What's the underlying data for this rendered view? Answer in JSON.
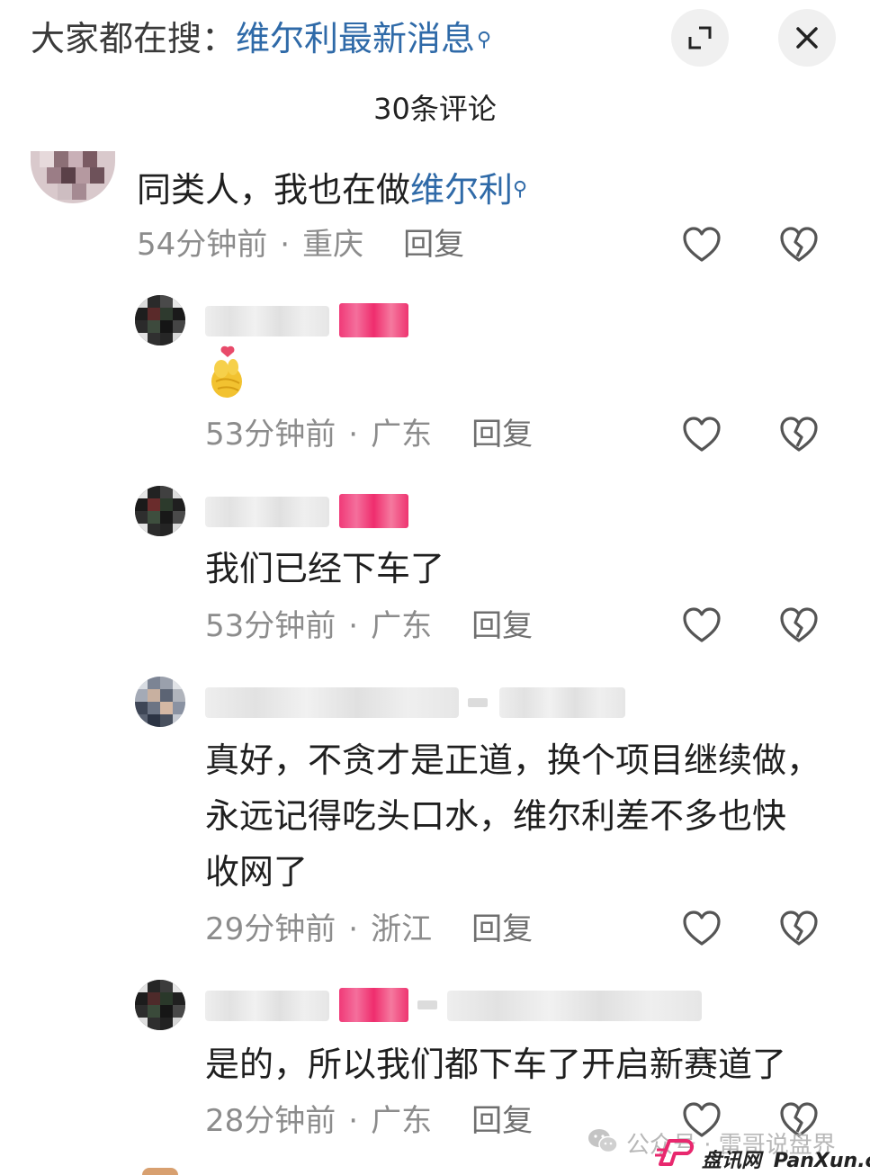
{
  "header": {
    "search_prefix": "大家都在搜：",
    "search_keyword": "维尔利最新消息",
    "comment_count": "30条评论"
  },
  "comments": [
    {
      "text_plain": "同类人，我也在做",
      "text_keyword": "维尔利",
      "time": "54分钟前",
      "location": "重庆",
      "reply": "回复"
    },
    {
      "emoji": "🫰",
      "time": "53分钟前",
      "location": "广东",
      "reply": "回复"
    },
    {
      "text": "我们已经下车了",
      "time": "53分钟前",
      "location": "广东",
      "reply": "回复"
    },
    {
      "lines": [
        "真好，不贪才是正道，换个项目继续做，",
        "永远记得吃头口水，维尔利差不多也快",
        "收网了"
      ],
      "time": "29分钟前",
      "location": "浙江",
      "reply": "回复"
    },
    {
      "text": "是的，所以我们都下车了开启新赛道了",
      "time": "28分钟前",
      "location": "广东",
      "reply": "回复"
    }
  ],
  "watermark": {
    "wechat": "公众号 · 雷哥说盘界",
    "site_cn": "盘讯网",
    "site_en": "PanXun.cc"
  },
  "colors": {
    "keyword": "#2f6aa8",
    "badge": "#f03a78",
    "meta": "#8c8c8c"
  },
  "icons": [
    "search-icon",
    "expand-icon",
    "close-icon",
    "heart-icon",
    "broken-heart-icon",
    "wechat-icon"
  ]
}
